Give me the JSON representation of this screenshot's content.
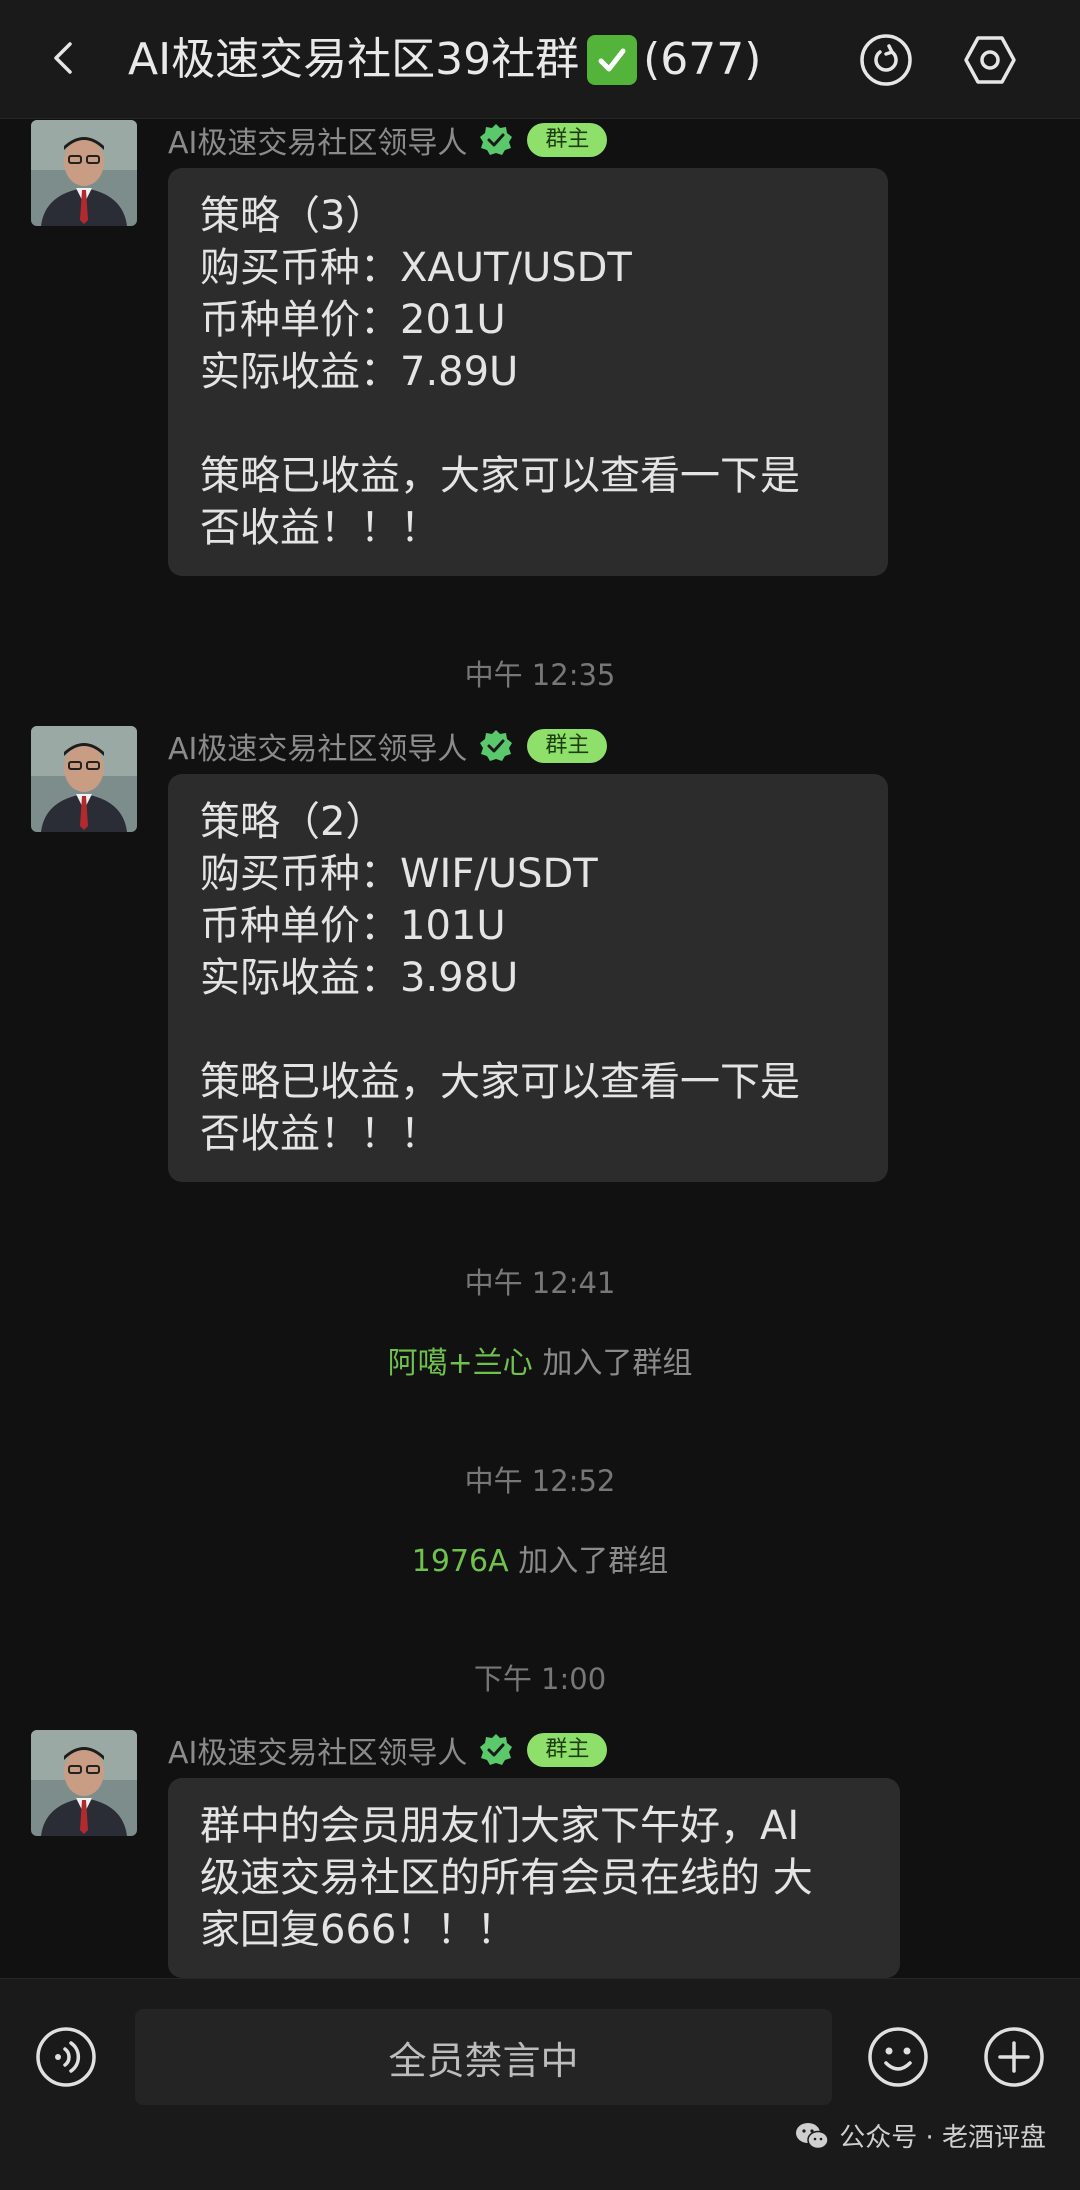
{
  "header": {
    "title": "AI极速交易社区39社群",
    "member_count": "(677)",
    "back_icon": "chevron-left-icon",
    "call_icon": "voice-call-icon",
    "settings_icon": "settings-icon"
  },
  "messages": [
    {
      "sender": "AI极速交易社区领导人",
      "badge": "群主",
      "lines": [
        "策略（3）",
        "购买币种：XAUT/USDT",
        "币种单价：201U",
        "实际收益：7.89U",
        "",
        "策略已收益，大家可以查看一下是",
        "否收益！！！"
      ]
    },
    {
      "sender": "AI极速交易社区领导人",
      "badge": "群主",
      "lines": [
        "策略（2）",
        "购买币种：WIF/USDT",
        "币种单价：101U",
        "实际收益：3.98U",
        "",
        "策略已收益，大家可以查看一下是",
        "否收益！！！"
      ]
    },
    {
      "sender": "AI极速交易社区领导人",
      "badge": "群主",
      "lines": [
        "群中的会员朋友们大家下午好，AI",
        "级速交易社区的所有会员在线的 大",
        "家回复666！！！"
      ]
    }
  ],
  "timestamps": [
    "中午 12:35",
    "中午 12:41",
    "中午 12:52",
    "下午 1:00"
  ],
  "system_messages": [
    {
      "who": "阿噶+兰心",
      "text": " 加入了群组"
    },
    {
      "who": "1976A",
      "text": " 加入了群组"
    }
  ],
  "bottom_bar": {
    "muted_text": "全员禁言中",
    "voice_icon": "voice-input-icon",
    "emoji_icon": "emoji-icon",
    "plus_icon": "plus-icon"
  },
  "watermark": {
    "text": "公众号 · 老酒评盘"
  },
  "colors": {
    "background": "#111111",
    "bubble": "#2c2c2c",
    "badge": "#8ee06a",
    "join_name": "#6fc04d",
    "verified": "#5bc86b"
  }
}
